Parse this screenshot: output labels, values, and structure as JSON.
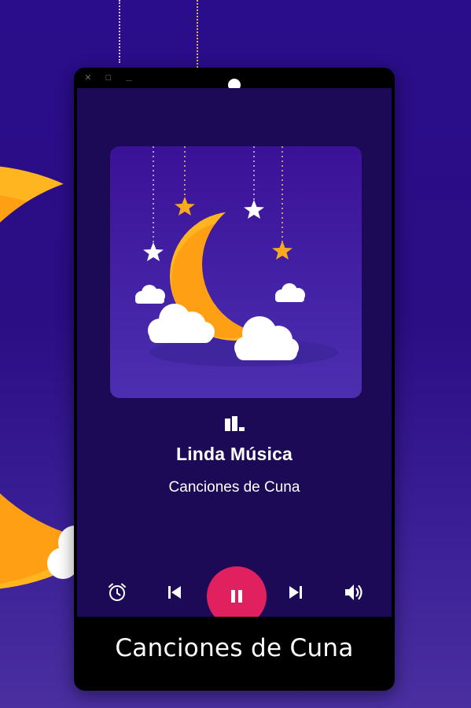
{
  "player": {
    "track_title": "Linda Música",
    "track_artist": "Canciones de Cuna",
    "state": "playing"
  },
  "window": {
    "controls": [
      "close",
      "maximize",
      "minimize"
    ]
  },
  "controls": [
    {
      "name": "alarm",
      "icon": "alarm-clock-icon"
    },
    {
      "name": "previous",
      "icon": "skip-previous-icon"
    },
    {
      "name": "pause",
      "icon": "pause-icon"
    },
    {
      "name": "next",
      "icon": "skip-next-icon"
    },
    {
      "name": "volume",
      "icon": "volume-icon"
    }
  ],
  "caption": {
    "text": "Canciones de Cuna"
  },
  "colors": {
    "background": "#2a0d8a",
    "screen": "#1d0a57",
    "accent_play": "#e0205f",
    "moon": "#ffa31a",
    "star": "#f7a91f",
    "text": "#ffffff"
  }
}
